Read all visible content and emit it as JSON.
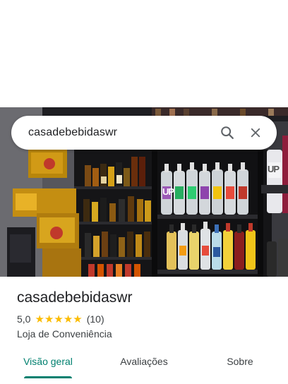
{
  "search": {
    "query": "casadebebidaswr",
    "search_icon": "search-icon",
    "close_icon": "close-icon"
  },
  "hero": {
    "image": "store-interior-photo",
    "bottle_label_text": "UP",
    "side_bottle_label_text": "UP"
  },
  "place": {
    "name": "casadebebidaswr",
    "rating": "5,0",
    "stars": 5,
    "review_count": "(10)",
    "category": "Loja de Conveniência"
  },
  "tabs": [
    {
      "label": "Visão geral",
      "active": true
    },
    {
      "label": "Avaliações",
      "active": false
    },
    {
      "label": "Sobre",
      "active": false
    }
  ],
  "colors": {
    "accent": "#00806f",
    "star": "#fbbc04",
    "text": "#202124",
    "secondary_text": "#3c4043"
  }
}
